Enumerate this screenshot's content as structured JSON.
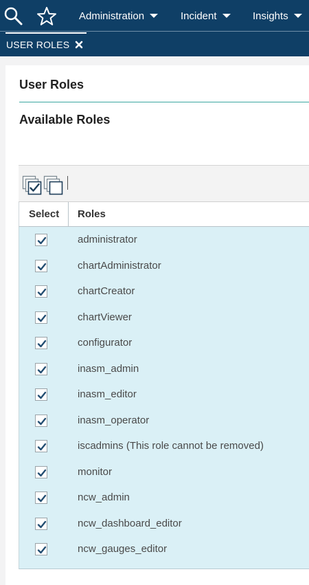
{
  "nav": {
    "items": [
      {
        "label": "Administration"
      },
      {
        "label": "Incident"
      },
      {
        "label": "Insights"
      }
    ]
  },
  "tab": {
    "label": "USER ROLES"
  },
  "page": {
    "title": "User Roles",
    "section_title": "Available Roles"
  },
  "table": {
    "headers": {
      "select": "Select",
      "roles": "Roles"
    },
    "rows": [
      {
        "role": "administrator",
        "checked": true
      },
      {
        "role": "chartAdministrator",
        "checked": true
      },
      {
        "role": "chartCreator",
        "checked": true
      },
      {
        "role": "chartViewer",
        "checked": true
      },
      {
        "role": "configurator",
        "checked": true
      },
      {
        "role": "inasm_admin",
        "checked": true
      },
      {
        "role": "inasm_editor",
        "checked": true
      },
      {
        "role": "inasm_operator",
        "checked": true
      },
      {
        "role": "iscadmins (This role cannot be removed)",
        "checked": true
      },
      {
        "role": "monitor",
        "checked": true
      },
      {
        "role": "ncw_admin",
        "checked": true
      },
      {
        "role": "ncw_dashboard_editor",
        "checked": true
      },
      {
        "role": "ncw_gauges_editor",
        "checked": true
      }
    ]
  },
  "icons": {
    "search": "search-icon",
    "favorites": "star-icon",
    "close_tab": "close-icon",
    "select_all": "select-all-icon",
    "deselect_all": "deselect-all-icon",
    "checkbox": "checkbox-checked-icon"
  },
  "colors": {
    "header_bg": "#0f3f66",
    "accent_rule": "#3aa6a0",
    "row_bg": "#daf0f6",
    "checkmark": "#234e72"
  }
}
